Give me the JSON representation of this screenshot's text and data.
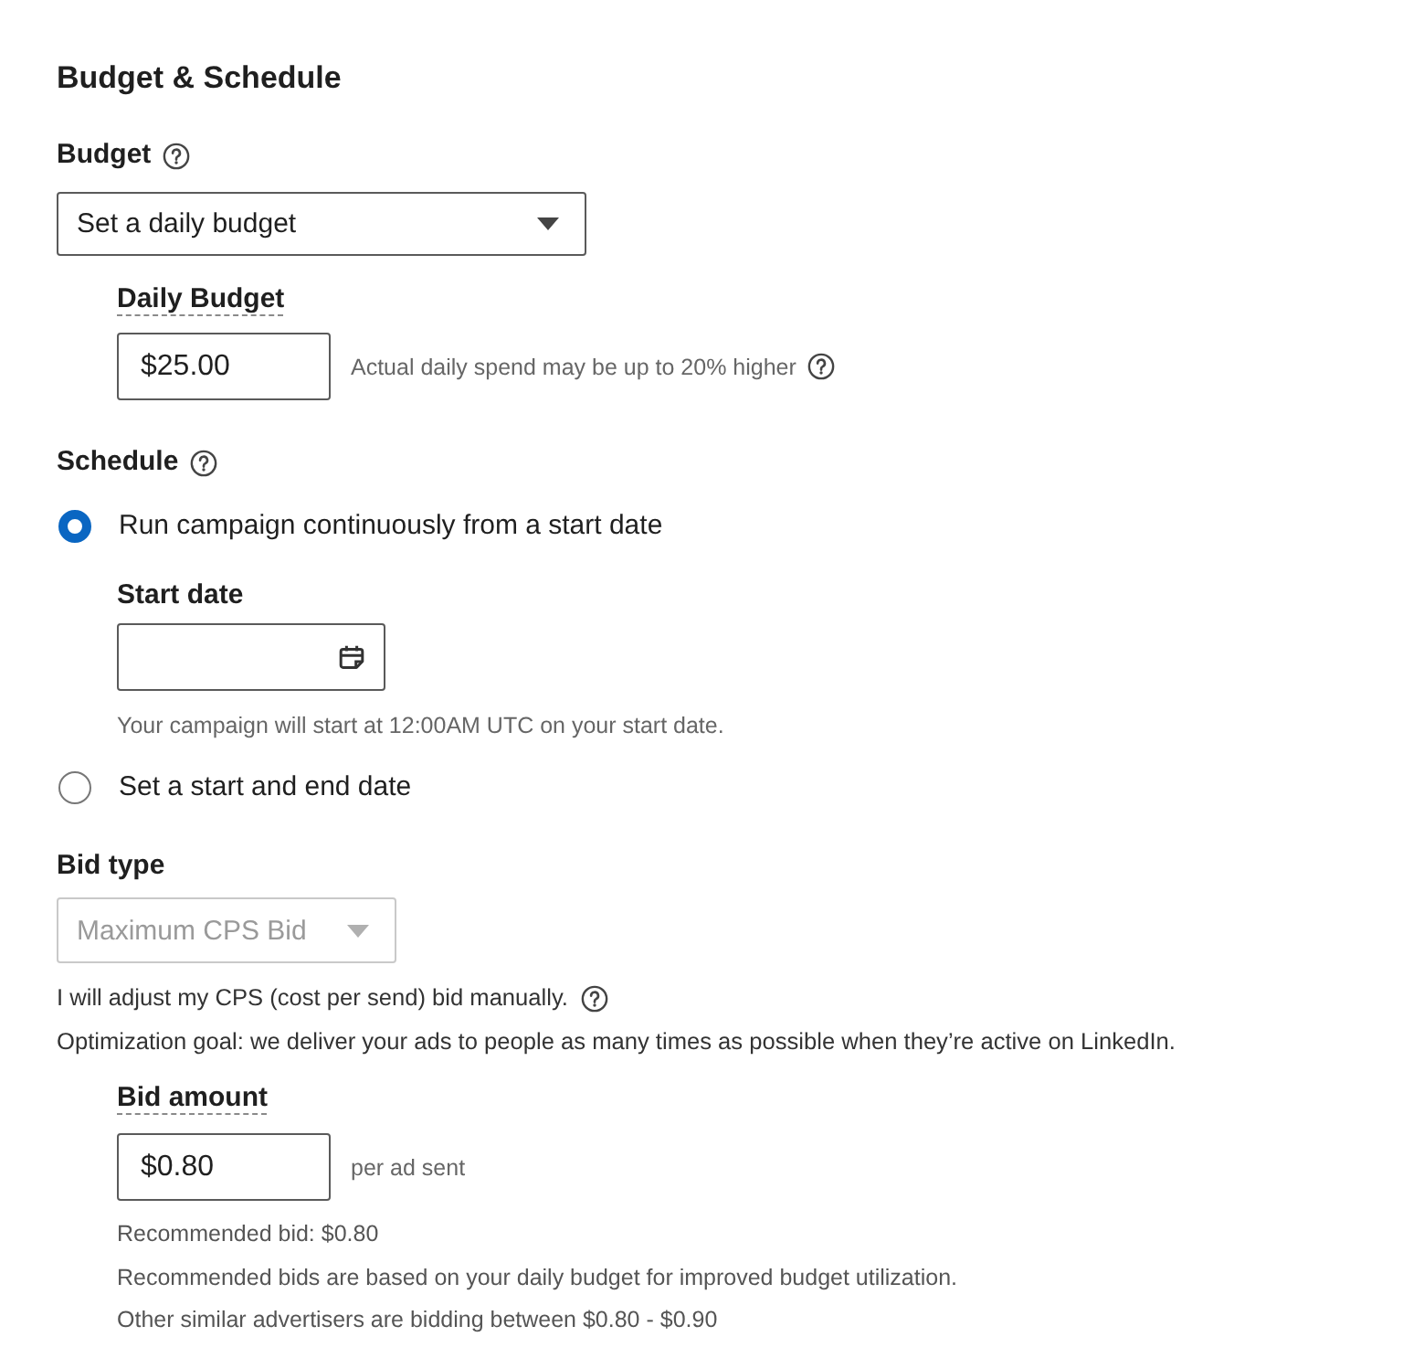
{
  "section_title": "Budget & Schedule",
  "budget": {
    "label": "Budget",
    "dropdown": {
      "value": "Set a daily budget",
      "disabled": false
    },
    "daily_budget": {
      "label": "Daily Budget",
      "value": "$25.00",
      "hint": "Actual daily spend may be up to 20% higher"
    }
  },
  "schedule": {
    "label": "Schedule",
    "options": [
      {
        "label": "Run campaign continuously from a start date",
        "selected": true
      },
      {
        "label": "Set a start and end date",
        "selected": false
      }
    ],
    "start_date": {
      "label": "Start date",
      "note": "Your campaign will start at 12:00AM UTC on your start date."
    }
  },
  "bid_type": {
    "label": "Bid type",
    "dropdown": {
      "value": "Maximum CPS Bid",
      "disabled": true
    },
    "notes": [
      "I will adjust my CPS (cost per send) bid manually.",
      "Optimization goal: we deliver your ads to people as many times as possible when they’re active on LinkedIn."
    ]
  },
  "bid_amount": {
    "label": "Bid amount",
    "value": "$0.80",
    "unit": "per ad sent",
    "notes": [
      "Recommended bid: $0.80",
      "Recommended bids are based on your daily budget for improved budget utilization.",
      "Other similar advertisers are bidding between $0.80 - $0.90"
    ]
  }
}
